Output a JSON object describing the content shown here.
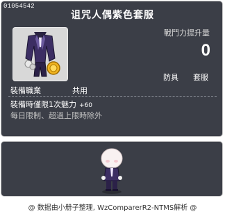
{
  "item": {
    "id": "01054542",
    "title": "诅咒人偶紫色套服",
    "attack_increase_label": "戰鬥力提升量",
    "attack_increase_value": "0",
    "types": [
      "防具",
      "套服"
    ],
    "job_label": "裝備職業",
    "job_value": "共用",
    "effect_label": "裝備時僅限1次魅力",
    "effect_value": "+60",
    "limit_text": "每日限制、超過上限時除外"
  },
  "icons": {
    "item": "purple-suit-icon",
    "character": "character-preview"
  },
  "footer": {
    "text": "@ 数据由小册子整理, WzComparerR2-NTMS解析 @"
  },
  "colors": {
    "panel_bg": "#3b3e47",
    "panel_border": "#c8c8c8",
    "icon_bg": "#d8d8d8"
  }
}
